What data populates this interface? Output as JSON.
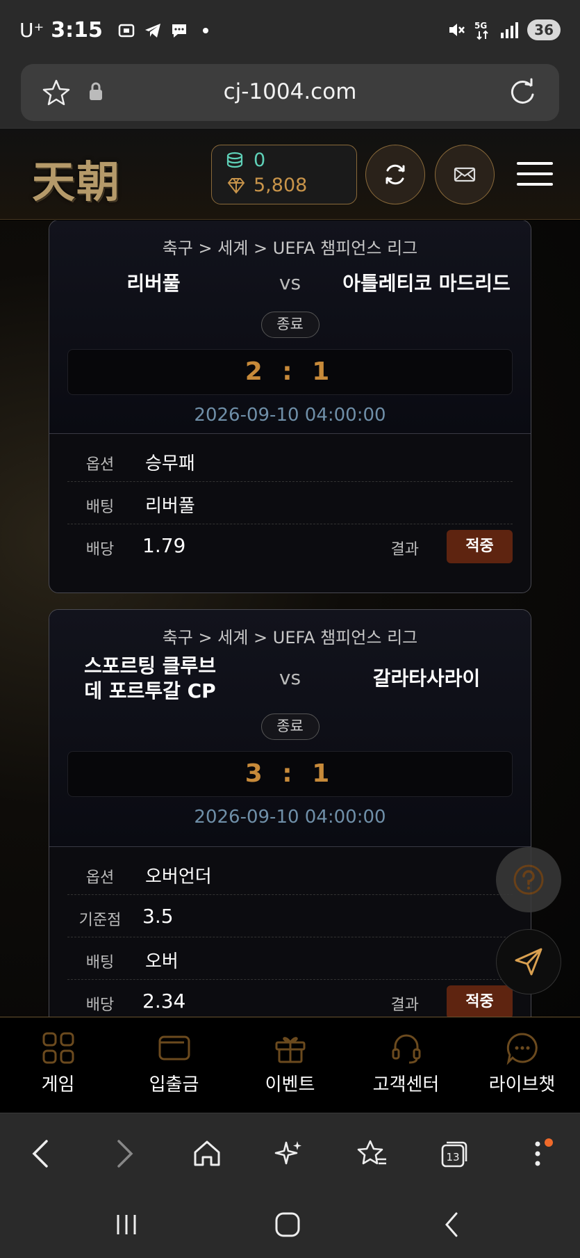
{
  "status_bar": {
    "carrier": "U⁺",
    "time": "3:15",
    "battery": "36"
  },
  "browser": {
    "url": "cj-1004.com",
    "tab_count": "13"
  },
  "header": {
    "logo": "天朝",
    "coins": "0",
    "gems": "5,808"
  },
  "matches": [
    {
      "league": "축구 > 세계 > UEFA 챔피언스 리그",
      "home_team": "리버풀",
      "vs": "vs",
      "away_team": "아틀레티코 마드리드",
      "status": "종료",
      "score": "2 : 1",
      "datetime": "2026-09-10 04:00:00",
      "rows": [
        {
          "label": "옵션",
          "value": "승무패"
        },
        {
          "label": "배팅",
          "value": "리버풀"
        },
        {
          "label": "배당",
          "value": "1.79"
        }
      ],
      "result_label": "결과",
      "result": "적중"
    },
    {
      "league": "축구 > 세계 > UEFA 챔피언스 리그",
      "home_team": "스포르팅 클루브 데 포르투갈 CP",
      "vs": "vs",
      "away_team": "갈라타사라이",
      "status": "종료",
      "score": "3 : 1",
      "datetime": "2026-09-10 04:00:00",
      "rows": [
        {
          "label": "옵션",
          "value": "오버언더"
        },
        {
          "label": "기준점",
          "value": "3.5"
        },
        {
          "label": "배팅",
          "value": "오버"
        },
        {
          "label": "배당",
          "value": "2.34"
        }
      ],
      "result_label": "결과",
      "result": "적중"
    }
  ],
  "site_nav": [
    {
      "label": "게임",
      "icon": "grid-icon"
    },
    {
      "label": "입출금",
      "icon": "wallet-icon"
    },
    {
      "label": "이벤트",
      "icon": "gift-icon"
    },
    {
      "label": "고객센터",
      "icon": "headset-icon"
    },
    {
      "label": "라이브챗",
      "icon": "chat-icon"
    }
  ],
  "colors": {
    "accent_gold": "#c78a3a",
    "hit_badge": "#5e2410",
    "teal": "#5fd1b8"
  }
}
